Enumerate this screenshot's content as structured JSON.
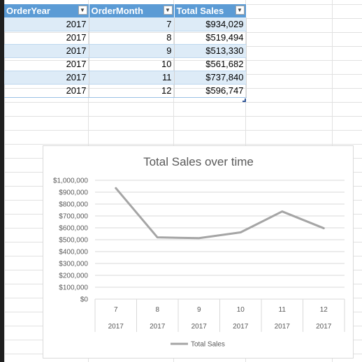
{
  "table": {
    "headers": [
      "OrderYear",
      "OrderMonth",
      "Total Sales"
    ],
    "rows": [
      {
        "year": "2017",
        "month": "7",
        "sales": "$934,029"
      },
      {
        "year": "2017",
        "month": "8",
        "sales": "$519,494"
      },
      {
        "year": "2017",
        "month": "9",
        "sales": "$513,330"
      },
      {
        "year": "2017",
        "month": "10",
        "sales": "$561,682"
      },
      {
        "year": "2017",
        "month": "11",
        "sales": "$737,840"
      },
      {
        "year": "2017",
        "month": "12",
        "sales": "$596,747"
      }
    ],
    "filter_icon": "dropdown-arrow-icon"
  },
  "chart_data": {
    "type": "line",
    "title": "Total Sales over time",
    "categories": [
      "7",
      "8",
      "9",
      "10",
      "11",
      "12"
    ],
    "category_groups": [
      "2017",
      "2017",
      "2017",
      "2017",
      "2017",
      "2017"
    ],
    "series": [
      {
        "name": "Total Sales",
        "values": [
          934029,
          519494,
          513330,
          561682,
          737840,
          596747
        ],
        "color": "#a5a5a5"
      }
    ],
    "ylim": [
      0,
      1000000
    ],
    "yticks": [
      "$0",
      "$100,000",
      "$200,000",
      "$300,000",
      "$400,000",
      "$500,000",
      "$600,000",
      "$700,000",
      "$800,000",
      "$900,000",
      "$1,000,000"
    ],
    "grid": true,
    "legend": "bottom"
  },
  "colors": {
    "header_bg": "#5b9bd5",
    "band_bg": "#ddebf7",
    "gridline": "#d9d9d9",
    "series": "#a5a5a5"
  }
}
